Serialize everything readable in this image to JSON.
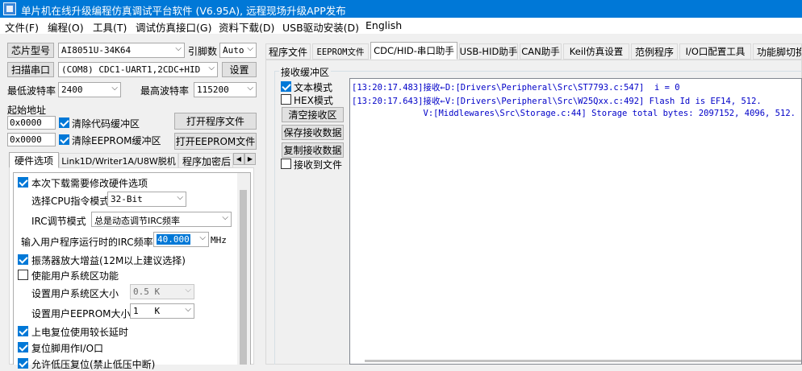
{
  "window": {
    "title": "单片机在线升级编程仿真调试平台软件 (V6.95A), 远程现场升级APP发布"
  },
  "menu": [
    "文件(F)",
    "编程(O)",
    "工具(T)",
    "调试仿真接口(G)",
    "资料下载(D)",
    "USB驱动安装(D)",
    "English"
  ],
  "left": {
    "chip_model_label": "芯片型号",
    "chip_model_value": "AI8051U-34K64",
    "pin_count_label": "引脚数",
    "pin_count_value": "Auto",
    "scan_port_label": "扫描串口",
    "port_value": "(COM8) CDC1-UART1,2CDC+HID",
    "settings_label": "设置",
    "min_baud_label": "最低波特率",
    "min_baud_value": "2400",
    "max_baud_label": "最高波特率",
    "max_baud_value": "115200",
    "start_address_label": "起始地址",
    "code_address": "0x0000",
    "clear_code_buffer_label": "清除代码缓冲区",
    "eeprom_address": "0x0000",
    "clear_eeprom_buffer_label": "清除EEPROM缓冲区",
    "open_program_file": "打开程序文件",
    "open_eeprom_file": "打开EEPROM文件",
    "tabs": [
      "硬件选项",
      "Link1D/Writer1A/U8W脱机",
      "程序加密后"
    ],
    "tab_arrows": [
      "◀",
      "▶"
    ],
    "hw_options": {
      "modify_hw_label": "本次下载需要修改硬件选项",
      "cpu_mode_label": "选择CPU指令模式",
      "cpu_mode_value": "32-Bit",
      "irc_mode_label": "IRC调节模式",
      "irc_mode_value": "总是动态调节IRC频率",
      "irc_freq_label": "输入用户程序运行时的IRC频率",
      "irc_freq_value": "40.000",
      "irc_freq_unit": "MHz",
      "osc_gain_label": "振荡器放大增益(12M以上建议选择)",
      "user_sys_area_label": "使能用户系统区功能",
      "sys_area_size_label": "设置用户系统区大小",
      "sys_area_size_value": "0.5 K",
      "eeprom_size_label": "设置用户EEPROM大小",
      "eeprom_size_value": "1   K",
      "long_delay_label": "上电复位使用较长延时",
      "reset_pin_io_label": "复位脚用作I/O口",
      "low_voltage_label": "允许低压复位(禁止低压中断)"
    }
  },
  "right": {
    "tabs": [
      "程序文件",
      "EEPROM文件",
      "CDC/HID-串口助手",
      "USB-HID助手",
      "CAN助手",
      "Keil仿真设置",
      "范例程序",
      "I/O口配置工具",
      "功能脚切换"
    ],
    "recv_buffer_label": "接收缓冲区",
    "text_mode_label": "文本模式",
    "hex_mode_label": "HEX模式",
    "clear_recv_label": "清空接收区",
    "save_recv_label": "保存接收数据",
    "copy_recv_label": "复制接收数据",
    "recv_to_file_label": "接收到文件",
    "log_lines": [
      "[13:20:17.483]接收←D:[Drivers\\Peripheral\\Src\\ST7793.c:547]  i = 0",
      "[13:20:17.643]接收←V:[Drivers\\Peripheral\\Src\\W25Qxx.c:492] Flash Id is EF14, 512.",
      "              V:[Middlewares\\Src\\Storage.c:44] Storage total bytes: 2097152, 4096, 512."
    ]
  },
  "colors": {
    "titlebar": "#0078d7",
    "accent": "#0078d7",
    "log_text": "#0000c8"
  },
  "icons": {
    "app": "app-icon",
    "dropdown": "chevron-down-icon",
    "checkbox": "check-icon"
  }
}
